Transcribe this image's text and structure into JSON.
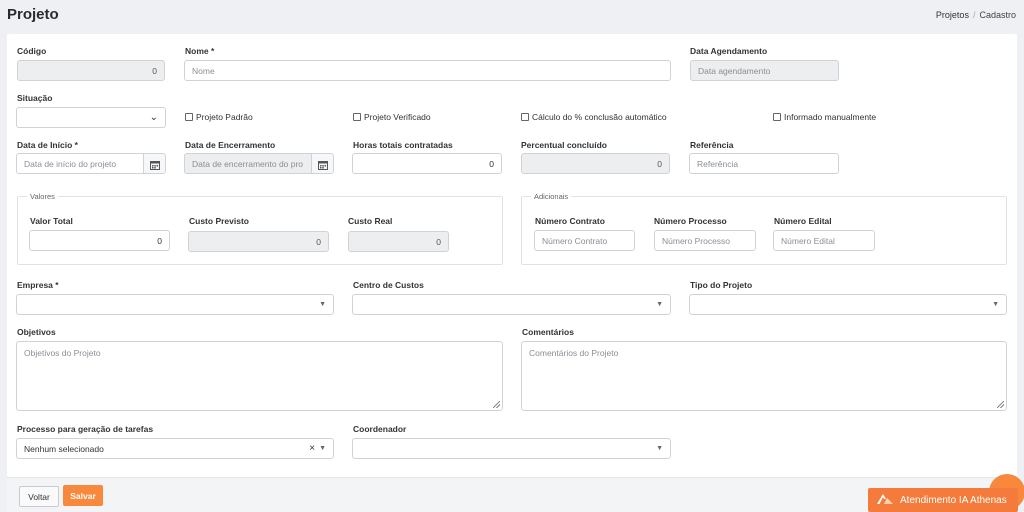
{
  "header": {
    "title": "Projeto",
    "breadcrumb": [
      "Projetos",
      "Cadastro"
    ],
    "breadcrumb_sep": "/"
  },
  "form": {
    "codigo": {
      "label": "Código",
      "value": "0"
    },
    "nome": {
      "label": "Nome",
      "placeholder": "Nome"
    },
    "data_agendamento": {
      "label": "Data Agendamento",
      "placeholder": "Data agendamento"
    },
    "situacao": {
      "label": "Situação"
    },
    "checkboxes": {
      "projeto_padrao": "Projeto Padrão",
      "projeto_verificado": "Projeto Verificado",
      "calculo_conclusao": "Cálculo do % conclusão automático",
      "informado_manualmente": "Informado manualmente"
    },
    "data_inicio": {
      "label": "Data de Início",
      "placeholder": "Data de início do projeto"
    },
    "data_encerramento": {
      "label": "Data de Encerramento",
      "placeholder": "Data de encerramento do pro"
    },
    "horas_totais": {
      "label": "Horas totais contratadas",
      "value": "0"
    },
    "percentual": {
      "label": "Percentual concluído",
      "value": "0"
    },
    "referencia": {
      "label": "Referência",
      "placeholder": "Referência"
    },
    "valores": {
      "legend": "Valores",
      "valor_total": {
        "label": "Valor Total",
        "value": "0"
      },
      "custo_previsto": {
        "label": "Custo Previsto",
        "value": "0"
      },
      "custo_real": {
        "label": "Custo Real",
        "value": "0"
      }
    },
    "adicionais": {
      "legend": "Adicionais",
      "numero_contrato": {
        "label": "Número Contrato",
        "placeholder": "Número Contrato"
      },
      "numero_processo": {
        "label": "Número Processo",
        "placeholder": "Número Processo"
      },
      "numero_edital": {
        "label": "Número Edital",
        "placeholder": "Número Edital"
      }
    },
    "empresa": {
      "label": "Empresa"
    },
    "centro_custos": {
      "label": "Centro de Custos"
    },
    "tipo_projeto": {
      "label": "Tipo do Projeto"
    },
    "objetivos": {
      "label": "Objetivos",
      "placeholder": "Objetivos do Projeto"
    },
    "comentarios": {
      "label": "Comentários",
      "placeholder": "Comentários do Projeto"
    },
    "processo": {
      "label": "Processo para geração de tarefas",
      "value": "Nenhum selecionado",
      "clear": "×"
    },
    "coordenador": {
      "label": "Coordenador"
    }
  },
  "footer": {
    "voltar": "Voltar",
    "salvar": "Salvar"
  },
  "assistant": {
    "label": "Atendimento IA Athenas"
  },
  "icons": {
    "calendar": "calendar-icon",
    "chevron": "chevron-down-icon",
    "caret": "caret-down-icon"
  },
  "colors": {
    "accent": "#f7883c",
    "background": "#eef0f4"
  }
}
